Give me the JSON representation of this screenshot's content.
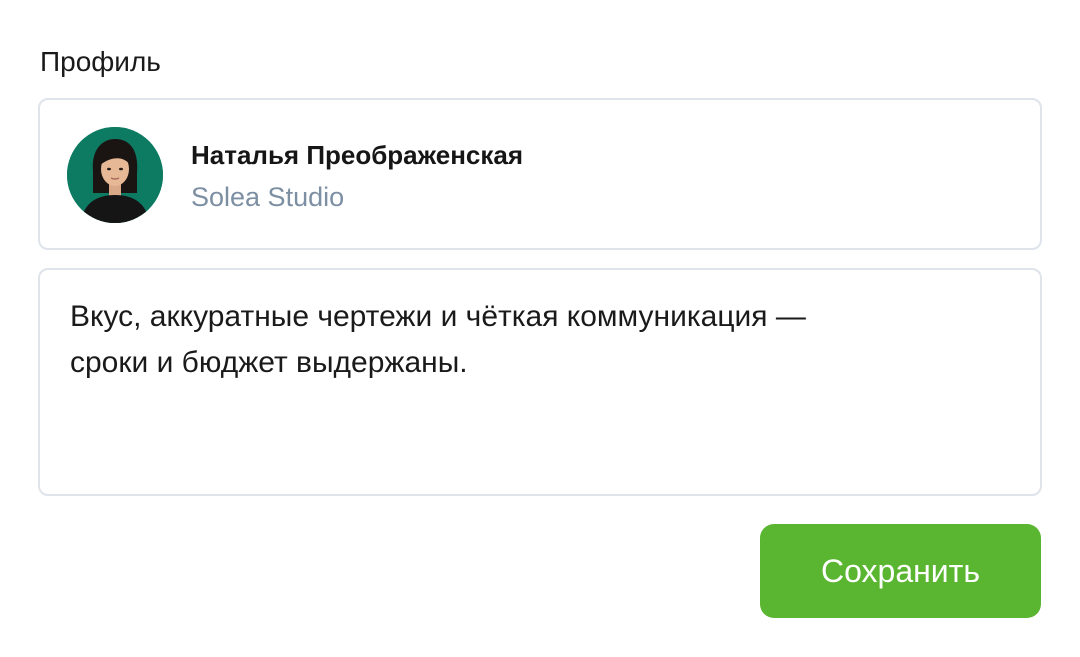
{
  "section": {
    "title": "Профиль"
  },
  "profile": {
    "name": "Наталья Преображенская",
    "company": "Solea Studio",
    "avatar_background": "#0d7a62"
  },
  "review": {
    "text": "Вкус, аккуратные чертежи и чёткая коммуникация —\nсроки и бюджет выдержаны."
  },
  "actions": {
    "save_label": "Сохранить",
    "save_color": "#5ab630"
  }
}
